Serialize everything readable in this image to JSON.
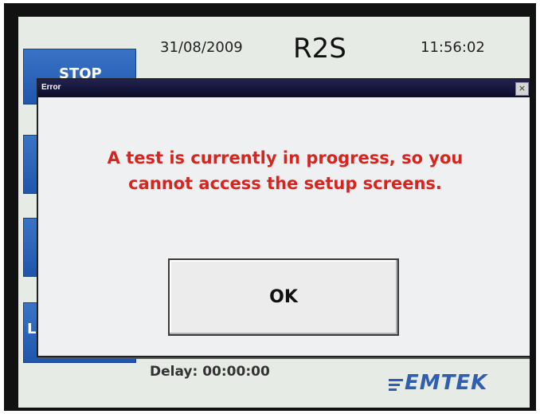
{
  "header": {
    "date": "31/08/2009",
    "title": "R2S",
    "time": "11:56:02"
  },
  "side_buttons": {
    "stop_label": "STOP",
    "bottom_fragment": "L"
  },
  "status": {
    "delay_label": "Delay:",
    "delay_value": "00:00:00"
  },
  "brand": {
    "logo_text": "EMTEK",
    "color": "#2f5fb3"
  },
  "dialog": {
    "title": "Error",
    "close_glyph": "×",
    "message_line1": "A test is currently in progress, so you",
    "message_line2": "cannot access the setup screens.",
    "ok_label": "OK",
    "message_color": "#d8241f"
  }
}
